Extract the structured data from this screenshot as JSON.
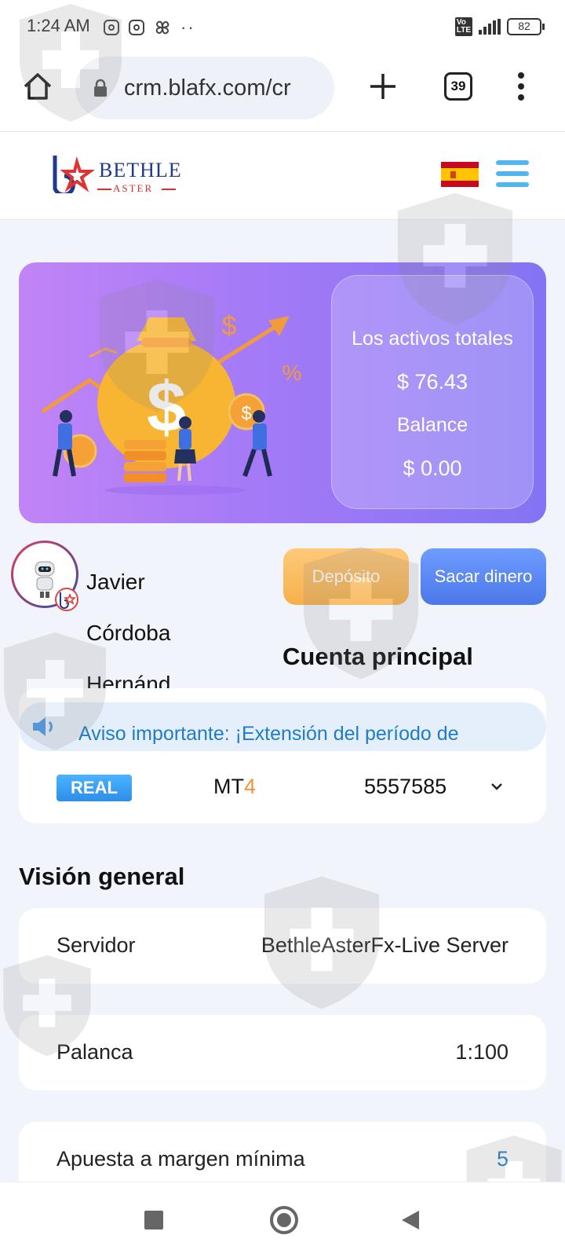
{
  "status_bar": {
    "time": "1:24 AM",
    "battery": "82"
  },
  "browser": {
    "url": "crm.blafx.com/cr",
    "tab_count": "39"
  },
  "brand": {
    "name": "BETHLE",
    "sub": "ASTER"
  },
  "banner": {
    "total_assets_label": "Los activos totales",
    "total_assets_value": "$ 76.43",
    "balance_label": "Balance",
    "balance_value": "$ 0.00"
  },
  "user": {
    "name": "Javier Córdoba Hernánd"
  },
  "actions": {
    "deposit": "Depósito",
    "withdraw": "Sacar dinero"
  },
  "account": {
    "title": "Cuenta principal",
    "notice": "Aviso importante: ¡Extensión del período de",
    "type_badge": "REAL",
    "platform_prefix": "MT",
    "platform_suffix": "4",
    "number": "5557585"
  },
  "overview": {
    "title": "Visión general",
    "rows": [
      {
        "label": "Servidor",
        "value": "BethleAsterFx-Live Server"
      },
      {
        "label": "Palanca",
        "value": "1:100"
      },
      {
        "label": "Apuesta a margen mínima",
        "value": "5"
      }
    ]
  },
  "colors": {
    "accent_blue": "#1f7cc7",
    "deposit": "#f6b04b",
    "withdraw": "#4a78e8",
    "banner_start": "#c184f6",
    "banner_end": "#8374f4"
  }
}
